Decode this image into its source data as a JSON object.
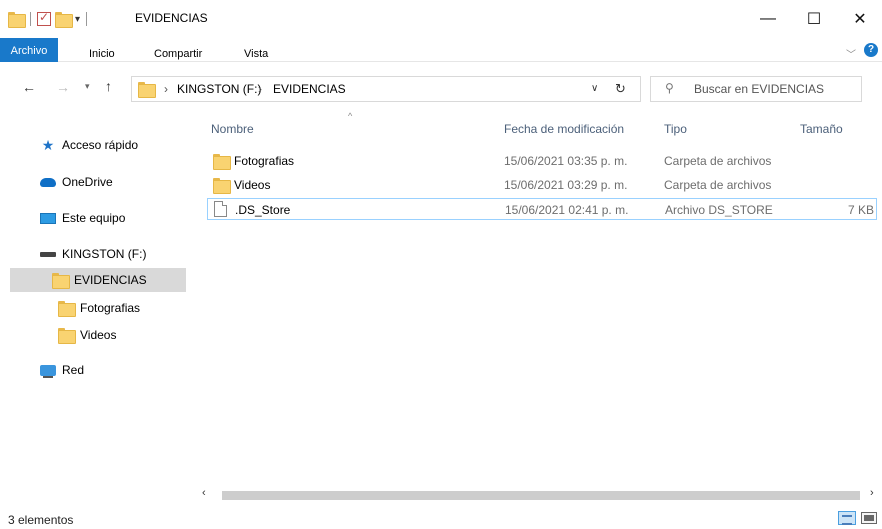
{
  "window": {
    "title": "EVIDENCIAS",
    "controls": {
      "minimize": "—",
      "maximize": "☐",
      "close": "✕"
    }
  },
  "ribbon": {
    "tabs": [
      {
        "label": "Archivo",
        "active": true
      },
      {
        "label": "Inicio"
      },
      {
        "label": "Compartir"
      },
      {
        "label": "Vista"
      }
    ],
    "help": "?"
  },
  "address": {
    "crumbs": [
      "KINGSTON (F:)",
      "EVIDENCIAS"
    ],
    "separator": "›"
  },
  "search": {
    "placeholder": "Buscar en EVIDENCIAS"
  },
  "navpane": {
    "items": [
      {
        "label": "Acceso rápido",
        "icon": "star-icon"
      },
      {
        "label": "OneDrive",
        "icon": "cloud-icon"
      },
      {
        "label": "Este equipo",
        "icon": "computer-icon"
      },
      {
        "label": "KINGSTON (F:)",
        "icon": "drive-icon"
      },
      {
        "label": "EVIDENCIAS",
        "icon": "folder-icon",
        "selected": true
      },
      {
        "label": "Fotografias",
        "icon": "folder-icon"
      },
      {
        "label": "Videos",
        "icon": "folder-icon"
      },
      {
        "label": "Red",
        "icon": "network-icon"
      }
    ]
  },
  "list": {
    "columns": [
      "Nombre",
      "Fecha de modificación",
      "Tipo",
      "Tamaño"
    ],
    "rows": [
      {
        "name": "Fotografias",
        "date": "15/06/2021 03:35 p. m.",
        "type": "Carpeta de archivos",
        "size": "",
        "icon": "folder-icon"
      },
      {
        "name": "Videos",
        "date": "15/06/2021 03:29 p. m.",
        "type": "Carpeta de archivos",
        "size": "",
        "icon": "folder-icon"
      },
      {
        "name": ".DS_Store",
        "date": "15/06/2021 02:41 p. m.",
        "type": "Archivo DS_STORE",
        "size": "7 KB",
        "icon": "file-icon",
        "selected": true
      }
    ]
  },
  "status": {
    "count": "3 elementos"
  },
  "colors": {
    "accent": "#1979ca",
    "selection": "#d9d9d9",
    "folder": "#f9d371"
  }
}
